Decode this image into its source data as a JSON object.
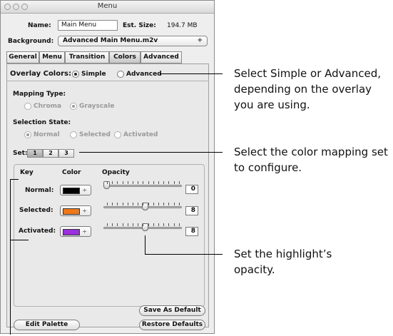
{
  "window": {
    "title": "Menu"
  },
  "name": {
    "label": "Name:",
    "value": "Main Menu"
  },
  "est_size": {
    "label": "Est. Size:",
    "value": "194.7 MB"
  },
  "background": {
    "label": "Background:",
    "value": "Advanced Main Menu.m2v",
    "arrow": "÷"
  },
  "tabs": [
    "General",
    "Menu",
    "Transition",
    "Colors",
    "Advanced"
  ],
  "selected_tab": "Colors",
  "overlay": {
    "label": "Overlay Colors:",
    "options": [
      "Simple",
      "Advanced"
    ],
    "selected": "Simple"
  },
  "mapping": {
    "label": "Mapping Type:",
    "options": [
      "Chroma",
      "Grayscale"
    ],
    "selected": "Grayscale"
  },
  "selection_state": {
    "label": "Selection State:",
    "options": [
      "Normal",
      "Selected",
      "Activated"
    ],
    "selected": "Normal"
  },
  "set": {
    "label": "Set:",
    "options": [
      "1",
      "2",
      "3"
    ],
    "selected": "1"
  },
  "table": {
    "headers": [
      "Key",
      "Color",
      "Opacity"
    ],
    "rows": [
      {
        "key": "Normal:",
        "color": "#000000",
        "opacity": "0",
        "level": 0
      },
      {
        "key": "Selected:",
        "color": "#f07818",
        "opacity": "8",
        "level": 0.53
      },
      {
        "key": "Activated:",
        "color": "#9b2fe0",
        "opacity": "8",
        "level": 0.53
      }
    ],
    "arrow": "÷"
  },
  "buttons": {
    "save_default": "Save As Default",
    "edit_palette": "Edit Palette",
    "restore_defaults": "Restore Defaults"
  },
  "callouts": {
    "overlay": "Select Simple or Advanced, depending on the overlay you are using.",
    "set": "Select the color mapping set to configure.",
    "opacity": "Set the highlight’s opacity."
  }
}
